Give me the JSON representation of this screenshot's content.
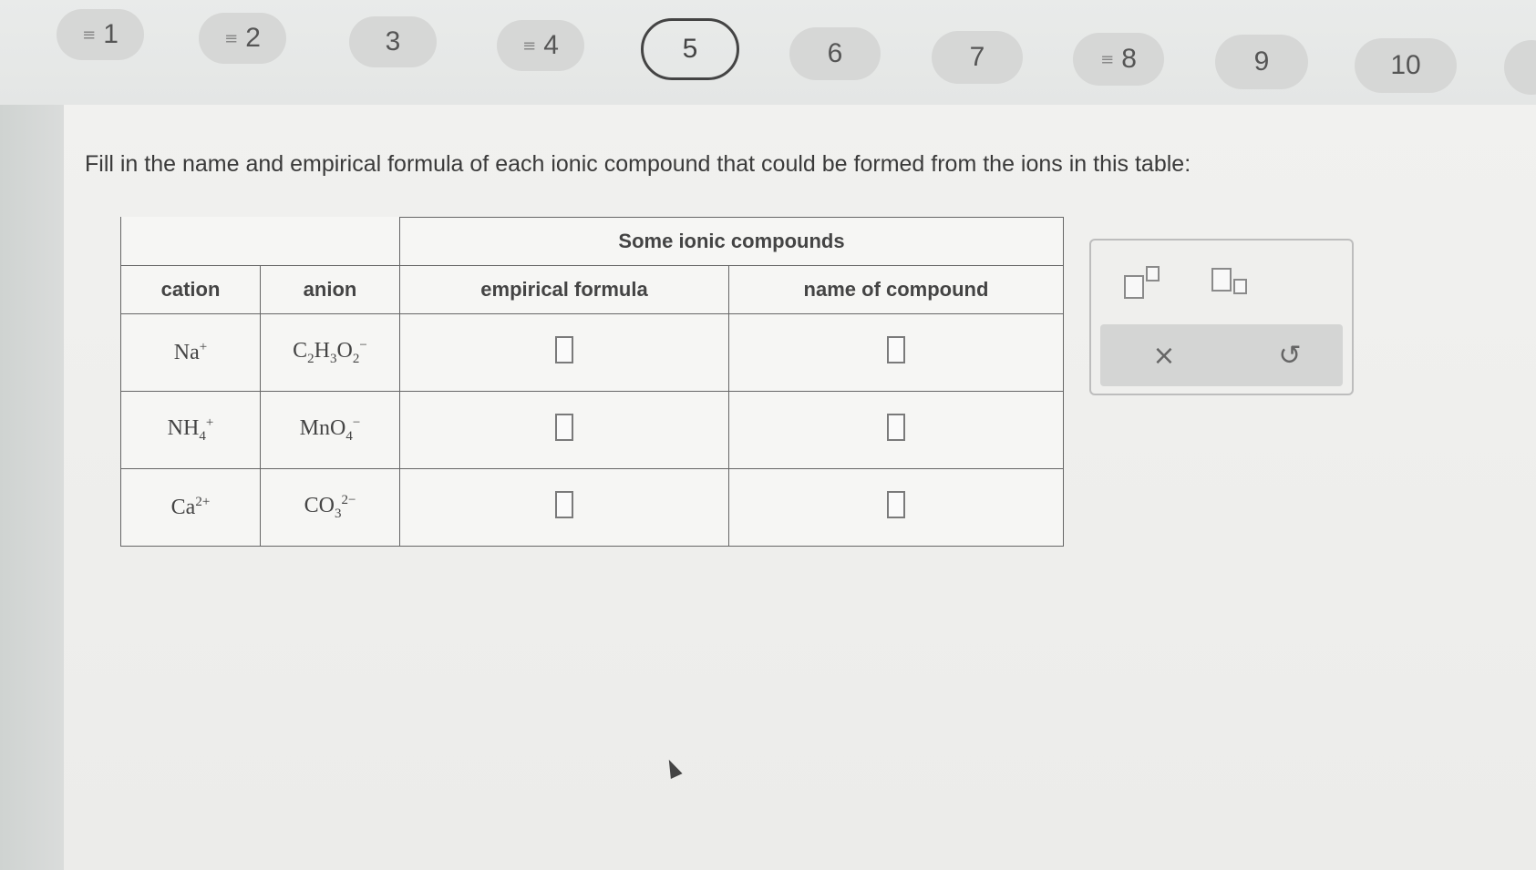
{
  "nav": {
    "questions": [
      {
        "number": "1",
        "flag": "≡"
      },
      {
        "number": "2",
        "flag": "≡"
      },
      {
        "number": "3",
        "flag": ""
      },
      {
        "number": "4",
        "flag": "≡"
      },
      {
        "number": "5",
        "flag": "",
        "active": true
      },
      {
        "number": "6",
        "flag": ""
      },
      {
        "number": "7",
        "flag": ""
      },
      {
        "number": "8",
        "flag": "≡"
      },
      {
        "number": "9",
        "flag": ""
      },
      {
        "number": "10",
        "flag": ""
      }
    ]
  },
  "question": {
    "prompt": "Fill in the name and empirical formula of each ionic compound that could be formed from the ions in this table:"
  },
  "table": {
    "caption": "Some ionic compounds",
    "headers": {
      "cation": "cation",
      "anion": "anion",
      "formula": "empirical formula",
      "name": "name of compound"
    },
    "rows": [
      {
        "cation": {
          "base": "Na",
          "sub": "",
          "sup": "+"
        },
        "anion": {
          "base": "C",
          "parts": "C2H3O2",
          "display": [
            "C",
            "2",
            "H",
            "3",
            "O",
            "2"
          ],
          "sup": "−"
        }
      },
      {
        "cation": {
          "base": "NH",
          "sub": "4",
          "sup": "+"
        },
        "anion": {
          "base": "MnO",
          "sub": "4",
          "sup": "−"
        }
      },
      {
        "cation": {
          "base": "Ca",
          "sub": "",
          "sup": "2+"
        },
        "anion": {
          "base": "CO",
          "sub": "3",
          "sup": "2−"
        }
      }
    ]
  },
  "palette": {
    "superscript_tool": "superscript-icon",
    "subscript_tool": "subscript-icon",
    "clear_label": "×",
    "undo_label": "↺"
  }
}
